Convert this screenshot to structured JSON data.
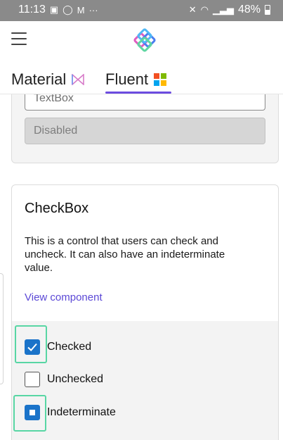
{
  "status_bar": {
    "time": "11:13",
    "left_icons": [
      "message-icon",
      "whatsapp-icon",
      "gmail-icon",
      "more-dots-icon"
    ],
    "more": "···",
    "right_icons": [
      "mute-icon",
      "wifi-icon",
      "signal-icon"
    ],
    "battery": "48%"
  },
  "app_bar": {
    "menu_icon": "hamburger-menu-icon",
    "logo": "app-logo-icon"
  },
  "tabs": [
    {
      "label": "Material",
      "icon": "material-logo-icon",
      "selected": false
    },
    {
      "label": "Fluent",
      "icon": "windows-logo-icon",
      "selected": true
    }
  ],
  "accent_color": "#6c4ce0",
  "textbox_card": {
    "textbox_value": "TextBox",
    "disabled_value": "Disabled"
  },
  "checkbox_card": {
    "title": "CheckBox",
    "description": "This is a control that users can check and uncheck. It can also have an indeterminate value.",
    "link": "View component",
    "items": [
      {
        "label": "Checked",
        "state": "checked",
        "highlighted": true
      },
      {
        "label": "Unchecked",
        "state": "unchecked",
        "highlighted": false
      },
      {
        "label": "Indeterminate",
        "state": "indeterminate",
        "highlighted": true
      }
    ],
    "checkbox_color": "#1a73c9",
    "highlight_color": "#58d6a4"
  }
}
